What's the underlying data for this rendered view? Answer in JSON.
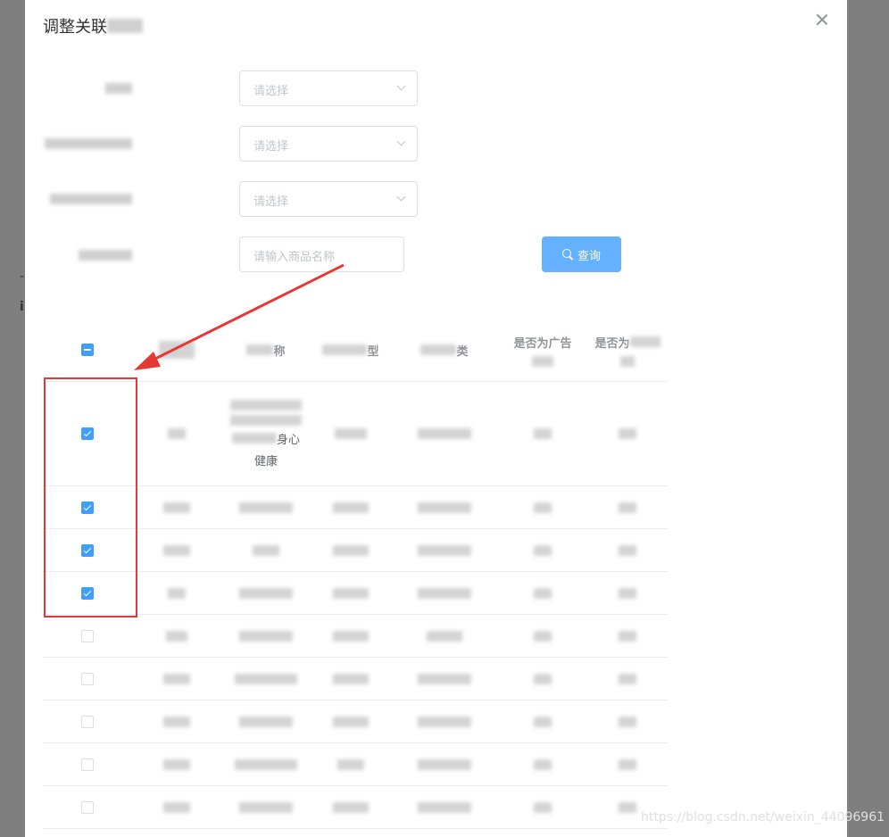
{
  "page": {
    "bg_fragment_1": "-",
    "bg_fragment_2": "i"
  },
  "dialog": {
    "title": "调整关联"
  },
  "form": {
    "select_placeholders": [
      "请选择",
      "请选择",
      "请选择"
    ],
    "name_input_placeholder": "请输入商品名称",
    "search_label": "查询"
  },
  "table": {
    "headers": [
      "称",
      "型",
      "类",
      "是否为广告",
      "是否为"
    ],
    "first_row_name_lines": [
      "身心",
      "健康"
    ],
    "row_checked": [
      true,
      true,
      true,
      true,
      false,
      false,
      false,
      false,
      false
    ]
  },
  "annotation": {
    "highlight_color": "#e53935"
  },
  "watermark": "https://blog.csdn.net/weixin_44096961"
}
